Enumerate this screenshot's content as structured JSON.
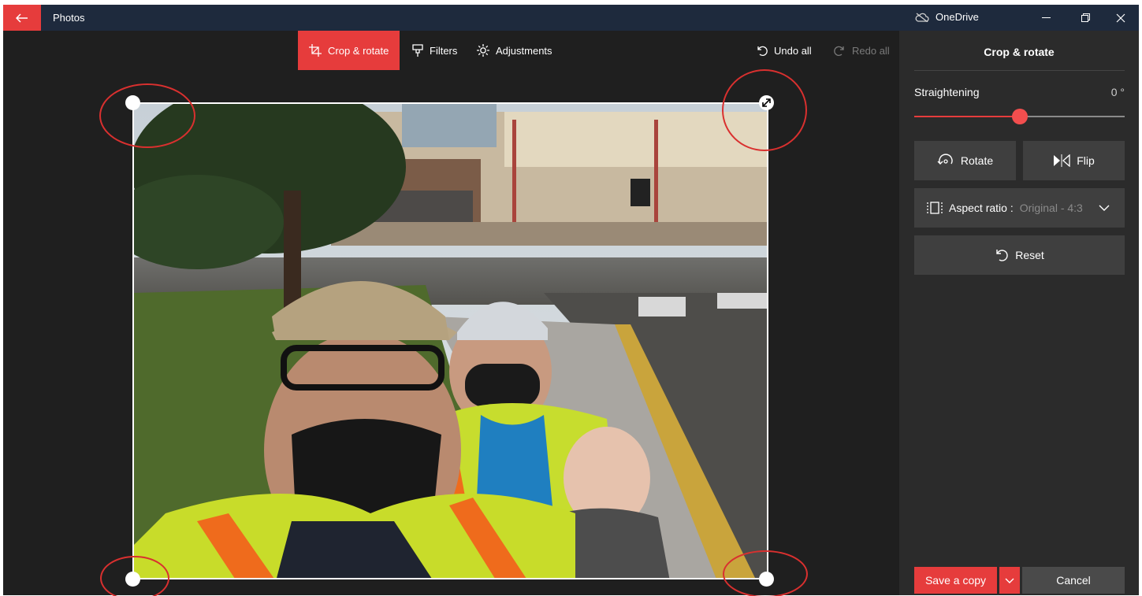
{
  "app": {
    "title": "Photos",
    "onedrive_label": "OneDrive"
  },
  "toolbar": {
    "crop_label": "Crop & rotate",
    "filters_label": "Filters",
    "adjustments_label": "Adjustments",
    "undo_label": "Undo all",
    "redo_label": "Redo all"
  },
  "panel": {
    "title": "Crop & rotate",
    "straightening_label": "Straightening",
    "straightening_value": "0 °",
    "straightening_level": 0.5,
    "rotate_label": "Rotate",
    "flip_label": "Flip",
    "aspect_label": "Aspect ratio :",
    "aspect_value": "Original - 4:3",
    "reset_label": "Reset",
    "save_label": "Save a copy",
    "cancel_label": "Cancel"
  },
  "colors": {
    "accent": "#e63c3c",
    "titlebar": "#1e2a3d",
    "panel": "#2b2b2b",
    "canvas": "#1f1f1f"
  },
  "icons": [
    "back-arrow-icon",
    "onedrive-cloud-icon",
    "minimize-icon",
    "maximize-icon",
    "close-icon",
    "crop-icon",
    "filters-icon",
    "adjustments-icon",
    "undo-icon",
    "redo-icon",
    "rotate-icon",
    "flip-icon",
    "aspect-ratio-icon",
    "chevron-down-icon",
    "reset-icon"
  ]
}
